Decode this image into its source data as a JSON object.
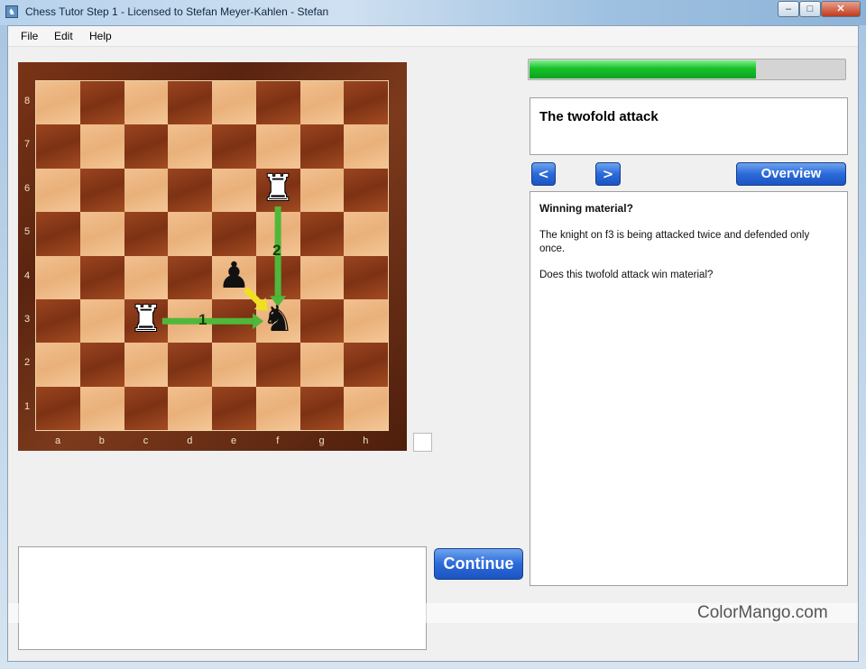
{
  "window": {
    "title": "Chess Tutor Step 1 - Licensed to Stefan Meyer-Kahlen - Stefan",
    "icon": "app-icon",
    "controls": {
      "minimize": "–",
      "maximize": "□",
      "close": "✕"
    }
  },
  "menu": {
    "items": [
      "File",
      "Edit",
      "Help"
    ]
  },
  "board": {
    "ranks": [
      "8",
      "7",
      "6",
      "5",
      "4",
      "3",
      "2",
      "1"
    ],
    "files": [
      "a",
      "b",
      "c",
      "d",
      "e",
      "f",
      "g",
      "h"
    ],
    "pieces": [
      {
        "square": "f6",
        "glyph": "♜",
        "color": "white",
        "icon": "white-rook-icon"
      },
      {
        "square": "e4",
        "glyph": "♟",
        "color": "black",
        "icon": "black-pawn-icon"
      },
      {
        "square": "c3",
        "glyph": "♜",
        "color": "white",
        "icon": "white-rook-icon"
      },
      {
        "square": "f3",
        "glyph": "♞",
        "color": "black",
        "icon": "black-knight-icon"
      }
    ],
    "arrows": [
      {
        "from": "c3",
        "to": "f3",
        "color": "#4fb83a",
        "label": "1"
      },
      {
        "from": "f6",
        "to": "f3",
        "color": "#4fb83a",
        "label": "2"
      },
      {
        "from": "e4",
        "to": "f3",
        "color": "#f0e020",
        "label": ""
      }
    ]
  },
  "progress": {
    "fraction": 0.72
  },
  "lesson": {
    "title": "The twofold attack"
  },
  "nav": {
    "prev": "<",
    "next": ">",
    "overview": "Overview"
  },
  "content": {
    "heading": "Winning material?",
    "paragraph1": "The knight on f3 is being attacked twice and defended only once.",
    "paragraph2": "Does this twofold attack win material?"
  },
  "continue_label": "Continue",
  "watermark": "ColorMango.com",
  "colors": {
    "accent": "#2b6ad9",
    "progress": "#17c02a"
  }
}
